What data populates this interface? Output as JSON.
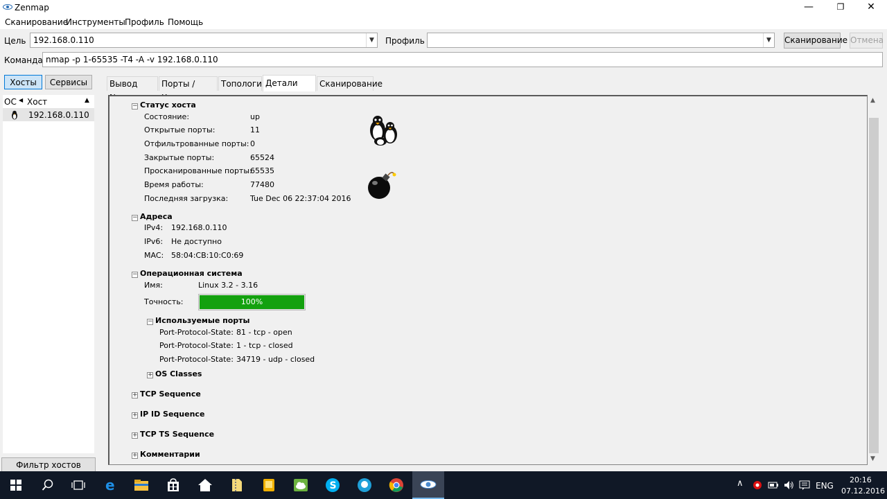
{
  "window": {
    "title": "Zenmap",
    "minimize": "—",
    "restore": "❐",
    "close": "✕"
  },
  "menu": [
    "Сканирование",
    "Инструменты",
    "Профиль",
    "Помощь"
  ],
  "target": {
    "label": "Цель",
    "value": "192.168.0.110"
  },
  "profile": {
    "label": "Профиль",
    "value": ""
  },
  "scan_button": "Сканирование",
  "cancel_button": "Отмена",
  "command": {
    "label": "Команда",
    "value": "nmap -p 1-65535 -T4 -A -v 192.168.0.110"
  },
  "left": {
    "hosts_button": "Хосты",
    "services_button": "Сервисы",
    "col_os": "ОС",
    "col_host": "Хост",
    "hosts": [
      {
        "ip": "192.168.0.110"
      }
    ],
    "filter_button": "Фильтр хостов"
  },
  "tabs": [
    "Вывод Nmap",
    "Порты / Хосты",
    "Топология",
    "Детали хоста",
    "Сканирование"
  ],
  "details": {
    "status": {
      "title": "Статус хоста",
      "rows": [
        {
          "k": "Состояние:",
          "v": "up"
        },
        {
          "k": "Открытые порты:",
          "v": "11"
        },
        {
          "k": "Отфильтрованные порты:",
          "v": "0"
        },
        {
          "k": "Закрытые порты:",
          "v": "65524"
        },
        {
          "k": "Просканированные порты:",
          "v": "65535"
        },
        {
          "k": "Время работы:",
          "v": "77480"
        },
        {
          "k": "Последняя загрузка:",
          "v": "Tue Dec 06 22:37:04 2016"
        }
      ]
    },
    "addresses": {
      "title": "Адреса",
      "rows": [
        {
          "k": "IPv4:",
          "v": "192.168.0.110"
        },
        {
          "k": "IPv6:",
          "v": "Не доступно"
        },
        {
          "k": "MAC:",
          "v": "58:04:CB:10:C0:69"
        }
      ]
    },
    "os": {
      "title": "Операционная система",
      "name_label": "Имя:",
      "name_value": "Linux 3.2 - 3.16",
      "accuracy_label": "Точность:",
      "accuracy_text": "100%",
      "accuracy_value": 1.0,
      "accuracy_color": "#13a10e",
      "used_ports": {
        "title": "Используемые порты",
        "rows": [
          {
            "k": "Port-Protocol-State:",
            "v": "81 - tcp - open"
          },
          {
            "k": "Port-Protocol-State:",
            "v": "1 - tcp - closed"
          },
          {
            "k": "Port-Protocol-State:",
            "v": "34719 - udp - closed"
          }
        ]
      },
      "os_classes": "OS Classes"
    },
    "collapsed": [
      "TCP Sequence",
      "IP ID Sequence",
      "TCP TS Sequence",
      "Комментарии"
    ]
  },
  "taskbar": {
    "lang": "ENG",
    "time": "20:16",
    "date": "07.12.2016"
  }
}
